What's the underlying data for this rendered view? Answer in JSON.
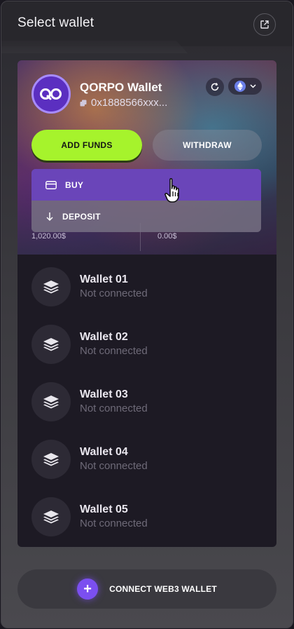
{
  "header": {
    "title": "Select wallet",
    "external_icon": "external-link-icon"
  },
  "active_wallet": {
    "name": "QORPO Wallet",
    "address": "0x1888566xxx...",
    "network_icon": "ethereum-icon"
  },
  "actions": {
    "add_funds": "ADD FUNDS",
    "withdraw": "WITHDRAW"
  },
  "dropdown": {
    "buy": "BUY",
    "deposit": "DEPOSIT"
  },
  "balances": {
    "left": "1,020.00$",
    "right": "0.00$"
  },
  "wallets": [
    {
      "name": "Wallet 01",
      "status": "Not connected"
    },
    {
      "name": "Wallet 02",
      "status": "Not connected"
    },
    {
      "name": "Wallet 03",
      "status": "Not connected"
    },
    {
      "name": "Wallet 04",
      "status": "Not connected"
    },
    {
      "name": "Wallet 05",
      "status": "Not connected"
    }
  ],
  "connect": {
    "label": "CONNECT WEB3 WALLET",
    "icon": "plus-icon"
  },
  "colors": {
    "accent_green": "#a6f32c",
    "accent_purple": "#7b4ff0",
    "dropdown_active": "#6a45b9"
  }
}
